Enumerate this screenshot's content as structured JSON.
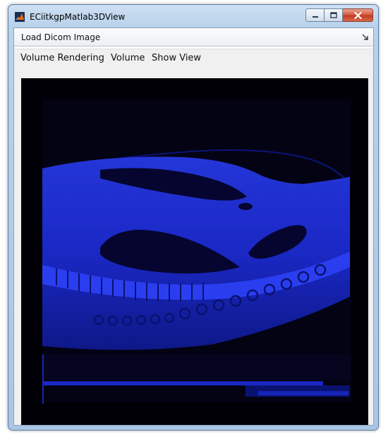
{
  "window": {
    "title": "ECiitkgpMatlab3DView",
    "controls": [
      "minimize",
      "maximize",
      "close"
    ]
  },
  "toolbar": {
    "label": "Load Dicom Image"
  },
  "menu": {
    "items": [
      "Volume Rendering",
      "Volume",
      "Show View"
    ]
  },
  "viewer": {
    "content": "ct-volume-render",
    "background": "#000000",
    "tint": "#1a2bff"
  },
  "icons": {
    "app": "matlab-logo-icon",
    "grip": "toolbar-collapse-icon"
  }
}
